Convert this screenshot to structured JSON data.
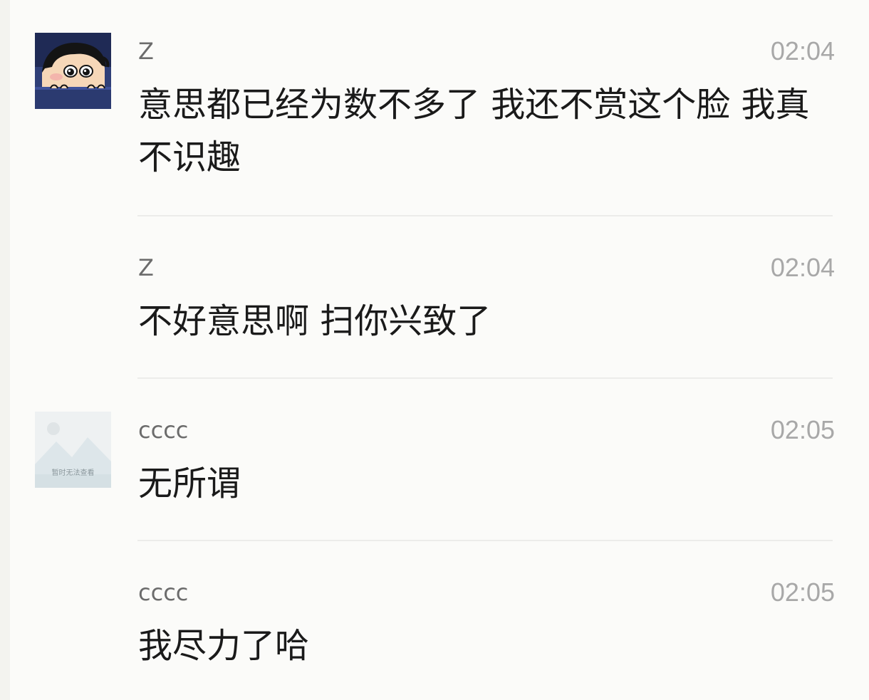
{
  "messages": [
    {
      "sender": "Z",
      "time": "02:04",
      "text": "意思都已经为数不多了 我还不赏这个脸 我真不识趣",
      "avatar": "cartoon-boy-avatar"
    },
    {
      "sender": "Z",
      "time": "02:04",
      "text": "不好意思啊 扫你兴致了"
    },
    {
      "sender": "cccc",
      "time": "02:05",
      "text": "无所谓",
      "avatar": "unavailable-image-avatar",
      "avatar_caption": "暂时无法查看"
    },
    {
      "sender": "cccc",
      "time": "02:05",
      "text": "我尽力了哈"
    }
  ],
  "colors": {
    "background": "#fbfbf9",
    "sender": "#6c6c6c",
    "time": "#a8a8a8",
    "text": "#1a1a1a",
    "divider": "#ececea"
  }
}
